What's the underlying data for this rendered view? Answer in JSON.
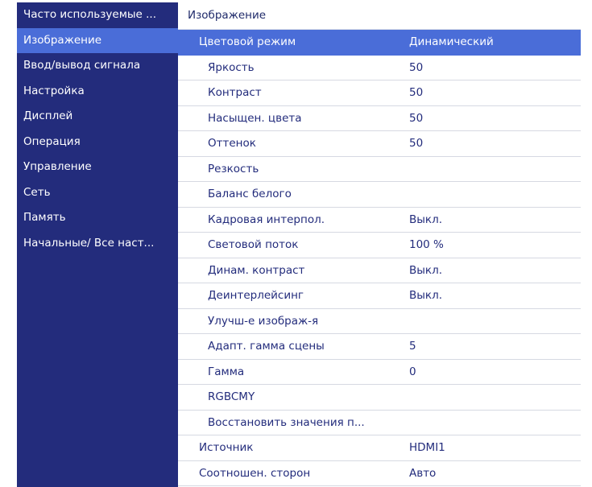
{
  "sidebar": {
    "items": [
      {
        "label": "Часто используемые ..."
      },
      {
        "label": "Изображение",
        "selected": true
      },
      {
        "label": "Ввод/вывод сигнала"
      },
      {
        "label": "Настройка"
      },
      {
        "label": "Дисплей"
      },
      {
        "label": "Операция"
      },
      {
        "label": "Управление"
      },
      {
        "label": "Сеть"
      },
      {
        "label": "Память"
      },
      {
        "label": "Начальные/ Все наст..."
      }
    ]
  },
  "main": {
    "title": "Изображение",
    "rows": [
      {
        "label": "Цветовой режим",
        "value": "Динамический",
        "selected": true,
        "level": "top"
      },
      {
        "label": "Яркость",
        "value": "50",
        "level": "sub"
      },
      {
        "label": "Контраст",
        "value": "50",
        "level": "sub"
      },
      {
        "label": "Насыщен. цвета",
        "value": "50",
        "level": "sub"
      },
      {
        "label": "Оттенок",
        "value": "50",
        "level": "sub"
      },
      {
        "label": "Резкость",
        "value": "",
        "level": "sub"
      },
      {
        "label": "Баланс белого",
        "value": "",
        "level": "sub"
      },
      {
        "label": "Кадровая интерпол.",
        "value": "Выкл.",
        "level": "sub"
      },
      {
        "label": "Световой поток",
        "value": "100 %",
        "level": "sub"
      },
      {
        "label": "Динам. контраст",
        "value": "Выкл.",
        "level": "sub"
      },
      {
        "label": "Деинтерлейсинг",
        "value": "Выкл.",
        "level": "sub"
      },
      {
        "label": "Улучш-е изображ-я",
        "value": "",
        "level": "sub"
      },
      {
        "label": "Адапт. гамма сцены",
        "value": "5",
        "level": "sub"
      },
      {
        "label": "Гамма",
        "value": "0",
        "level": "sub"
      },
      {
        "label": "RGBCMY",
        "value": "",
        "level": "sub"
      },
      {
        "label": "Восстановить значения п...",
        "value": "",
        "level": "sub"
      },
      {
        "label": "Источник",
        "value": "HDMI1",
        "level": "top"
      },
      {
        "label": "Соотношен. сторон",
        "value": "Авто",
        "level": "top"
      }
    ]
  },
  "colors": {
    "sidebar_bg": "#232c7c",
    "selected_bg": "#4a6dd8",
    "text_dark": "#232c7c",
    "text_light": "#ffffff"
  }
}
